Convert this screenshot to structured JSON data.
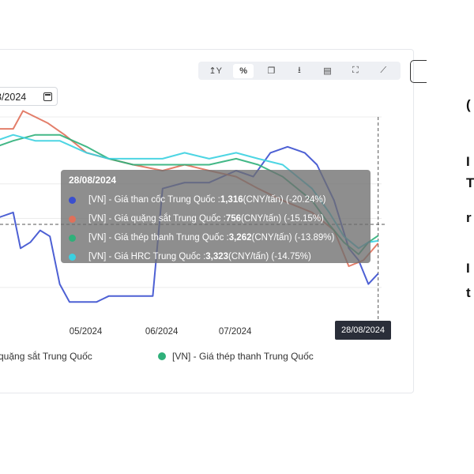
{
  "toolbar": {
    "items": [
      {
        "label": "↥Y",
        "icon": "y-axis-icon",
        "active": false
      },
      {
        "label": "%",
        "icon": "percent-icon",
        "active": true
      },
      {
        "label": "❐",
        "icon": "copy-icon",
        "active": false
      },
      {
        "label": "⭳",
        "icon": "download-icon",
        "active": false
      },
      {
        "label": "▤",
        "icon": "excel-icon",
        "active": false
      },
      {
        "label": "⛶",
        "icon": "fullscreen-icon",
        "active": false
      },
      {
        "label": "⟋",
        "icon": "indicator-icon",
        "active": false
      }
    ]
  },
  "date_input": {
    "value": "8/2024"
  },
  "tooltip": {
    "date": "28/08/2024",
    "rows": [
      {
        "label": "[VN] - Giá than cốc Trung Quốc : ",
        "value": "1,316",
        "suffix": " (CNY/tấn) (-20.24%)",
        "color": "#3a4fcf"
      },
      {
        "label": "[VN] - Giá quặng sắt Trung Quốc : ",
        "value": "756",
        "suffix": " (CNY/tấn) (-15.15%)",
        "color": "#e0705a"
      },
      {
        "label": "[VN] - Giá thép thanh Trung Quốc : ",
        "value": "3,262",
        "suffix": " (CNY/tấn) (-13.89%)",
        "color": "#2fb07a"
      },
      {
        "label": "[VN] - Giá HRC Trung Quốc : ",
        "value": "3,323",
        "suffix": " (CNY/tấn) (-14.75%)",
        "color": "#3ad0e0"
      }
    ]
  },
  "crosshair_label": "28/08/2024",
  "legend": [
    {
      "label": "quặng sắt Trung Quốc",
      "color": "#e0705a"
    },
    {
      "label": "[VN] - Giá thép thanh Trung Quốc",
      "color": "#2fb07a"
    }
  ],
  "right_text": [
    "(",
    "I",
    "T",
    "r",
    "I",
    "t"
  ],
  "chart_data": {
    "type": "line",
    "x_ticks": [
      "05/2024",
      "06/2024",
      "07/2024"
    ],
    "x_range": [
      "2024-03-25",
      "2024-08-31"
    ],
    "y_unit": "% change",
    "ylim": [
      -28,
      6
    ],
    "series": [
      {
        "name": "[VN] - Giá than cốc Trung Quốc",
        "color": "#3a4fcf",
        "points": [
          [
            "2024-03-25",
            -11
          ],
          [
            "2024-04-01",
            -10
          ],
          [
            "2024-04-04",
            -16
          ],
          [
            "2024-04-08",
            -15
          ],
          [
            "2024-04-12",
            -13
          ],
          [
            "2024-04-16",
            -14
          ],
          [
            "2024-04-20",
            -22
          ],
          [
            "2024-04-24",
            -25
          ],
          [
            "2024-05-05",
            -25
          ],
          [
            "2024-05-10",
            -24
          ],
          [
            "2024-05-20",
            -24
          ],
          [
            "2024-05-28",
            -24
          ],
          [
            "2024-06-01",
            -6
          ],
          [
            "2024-06-10",
            -5
          ],
          [
            "2024-06-20",
            -5
          ],
          [
            "2024-07-01",
            -3
          ],
          [
            "2024-07-08",
            -4
          ],
          [
            "2024-07-15",
            0
          ],
          [
            "2024-07-22",
            1
          ],
          [
            "2024-07-29",
            0
          ],
          [
            "2024-08-03",
            -2
          ],
          [
            "2024-08-10",
            -8
          ],
          [
            "2024-08-16",
            -16
          ],
          [
            "2024-08-20",
            -18
          ],
          [
            "2024-08-24",
            -22
          ],
          [
            "2024-08-28",
            -20.24
          ]
        ]
      },
      {
        "name": "[VN] - Giá quặng sắt Trung Quốc",
        "color": "#e0705a",
        "points": [
          [
            "2024-03-25",
            4
          ],
          [
            "2024-04-01",
            4
          ],
          [
            "2024-04-05",
            7
          ],
          [
            "2024-04-10",
            6
          ],
          [
            "2024-04-15",
            5
          ],
          [
            "2024-04-22",
            3
          ],
          [
            "2024-05-01",
            0
          ],
          [
            "2024-05-10",
            -1
          ],
          [
            "2024-05-20",
            -2
          ],
          [
            "2024-06-01",
            -3
          ],
          [
            "2024-06-10",
            -2
          ],
          [
            "2024-06-20",
            -3
          ],
          [
            "2024-07-01",
            -4
          ],
          [
            "2024-07-10",
            -6
          ],
          [
            "2024-07-20",
            -8
          ],
          [
            "2024-08-01",
            -10
          ],
          [
            "2024-08-10",
            -13
          ],
          [
            "2024-08-16",
            -19
          ],
          [
            "2024-08-22",
            -18
          ],
          [
            "2024-08-28",
            -15.15
          ]
        ]
      },
      {
        "name": "[VN] - Giá thép thanh Trung Quốc",
        "color": "#2fb07a",
        "points": [
          [
            "2024-03-25",
            1
          ],
          [
            "2024-04-01",
            2
          ],
          [
            "2024-04-10",
            3
          ],
          [
            "2024-04-20",
            3
          ],
          [
            "2024-05-01",
            1
          ],
          [
            "2024-05-10",
            -1
          ],
          [
            "2024-05-20",
            -2
          ],
          [
            "2024-06-01",
            -2
          ],
          [
            "2024-06-10",
            -2
          ],
          [
            "2024-06-20",
            -2
          ],
          [
            "2024-07-01",
            -1
          ],
          [
            "2024-07-10",
            -2
          ],
          [
            "2024-07-20",
            -4
          ],
          [
            "2024-08-01",
            -8
          ],
          [
            "2024-08-08",
            -12
          ],
          [
            "2024-08-14",
            -15
          ],
          [
            "2024-08-20",
            -17
          ],
          [
            "2024-08-24",
            -15
          ],
          [
            "2024-08-28",
            -13.89
          ]
        ]
      },
      {
        "name": "[VN] - Giá HRC Trung Quốc",
        "color": "#3ad0e0",
        "points": [
          [
            "2024-03-25",
            2
          ],
          [
            "2024-04-01",
            3
          ],
          [
            "2024-04-10",
            2
          ],
          [
            "2024-04-20",
            2
          ],
          [
            "2024-05-01",
            0
          ],
          [
            "2024-05-10",
            -1
          ],
          [
            "2024-05-20",
            -1
          ],
          [
            "2024-06-01",
            -1
          ],
          [
            "2024-06-10",
            0
          ],
          [
            "2024-06-20",
            -1
          ],
          [
            "2024-07-01",
            0
          ],
          [
            "2024-07-10",
            -1
          ],
          [
            "2024-07-20",
            -2
          ],
          [
            "2024-08-01",
            -6
          ],
          [
            "2024-08-08",
            -10
          ],
          [
            "2024-08-14",
            -14
          ],
          [
            "2024-08-20",
            -16
          ],
          [
            "2024-08-24",
            -15
          ],
          [
            "2024-08-28",
            -14.75
          ]
        ]
      }
    ]
  }
}
